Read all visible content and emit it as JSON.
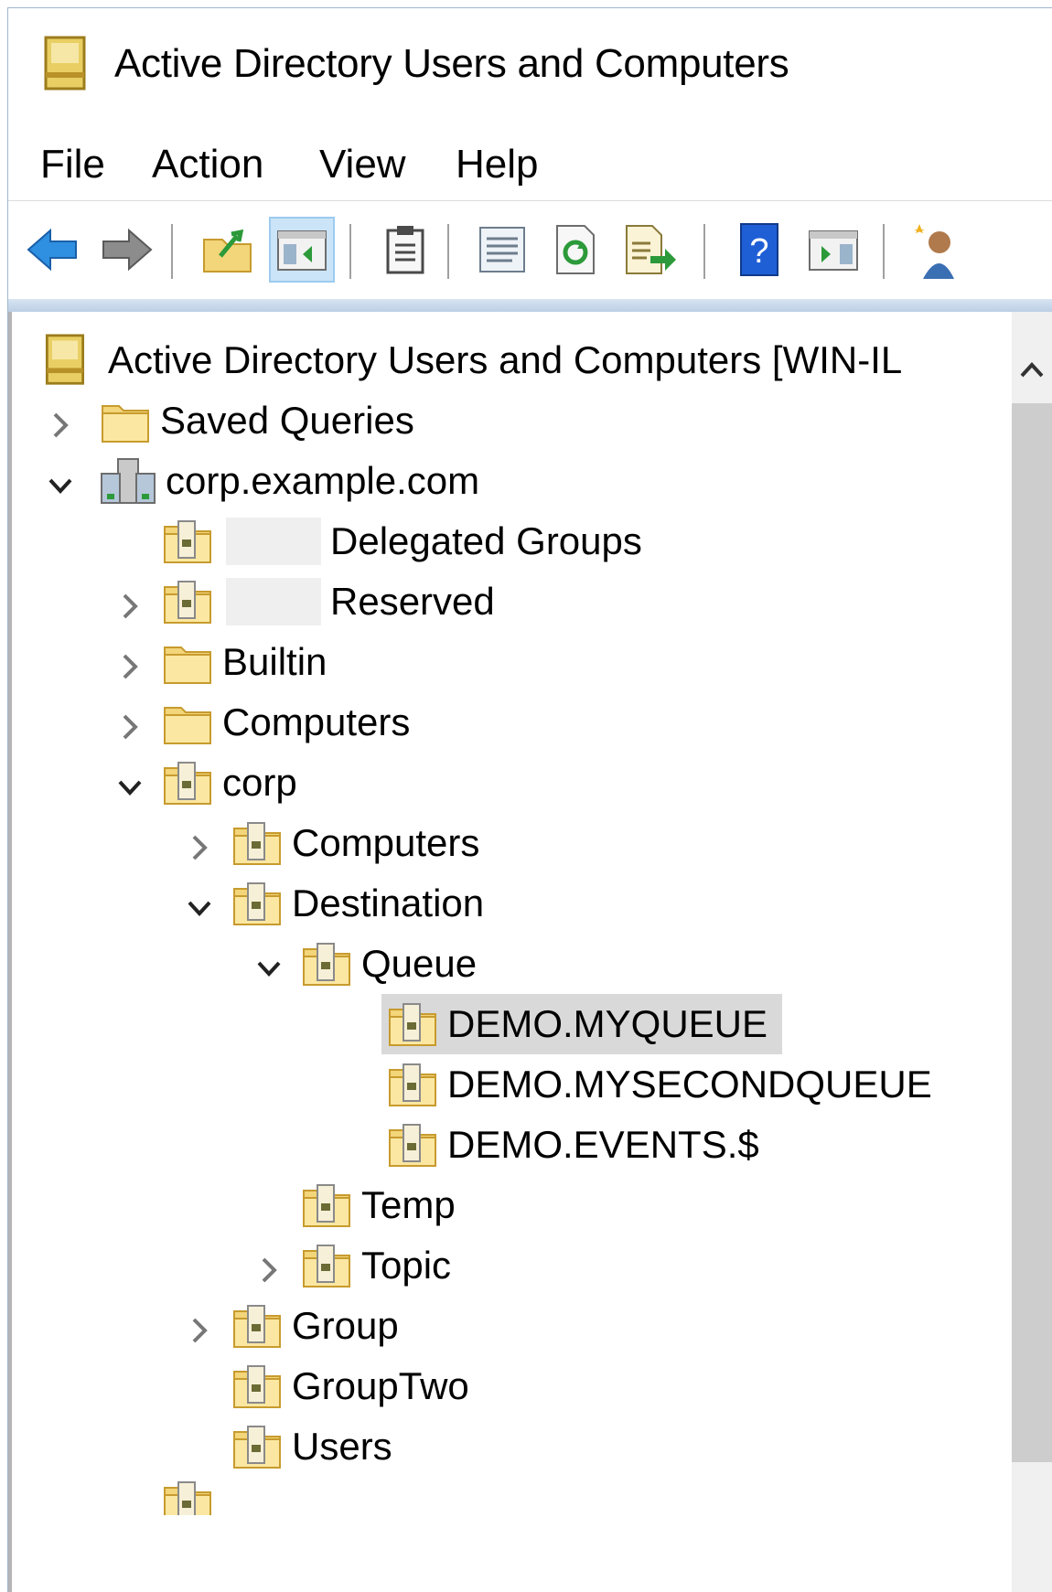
{
  "window": {
    "title": "Active Directory Users and Computers"
  },
  "menu": {
    "items": [
      "File",
      "Action",
      "View",
      "Help"
    ]
  },
  "toolbar": {
    "buttons": [
      "back-icon",
      "forward-icon",
      "up-folder-icon",
      "show-hide-console-tree-icon",
      "clipboard-icon",
      "properties-icon",
      "refresh-icon",
      "export-list-icon",
      "help-icon",
      "show-action-pane-icon",
      "new-user-icon"
    ]
  },
  "tree": {
    "root": "Active Directory Users and Computers [WIN-IL",
    "saved_queries": "Saved Queries",
    "domain": "corp.example.com",
    "delegated_groups": "Delegated Groups",
    "reserved": "Reserved",
    "builtin": "Builtin",
    "computers": "Computers",
    "corp": "corp",
    "corp_computers": "Computers",
    "destination": "Destination",
    "queue": "Queue",
    "demo_myqueue": "DEMO.MYQUEUE",
    "demo_mysecondqueue": "DEMO.MYSECONDQUEUE",
    "demo_events": "DEMO.EVENTS.$",
    "temp": "Temp",
    "topic": "Topic",
    "group": "Group",
    "group_two": "GroupTwo",
    "users": "Users",
    "selected": "DEMO.MYQUEUE"
  },
  "colors": {
    "accent": "#cce4f7",
    "selection": "#d9d9d9",
    "folder": "#f3d57a"
  }
}
